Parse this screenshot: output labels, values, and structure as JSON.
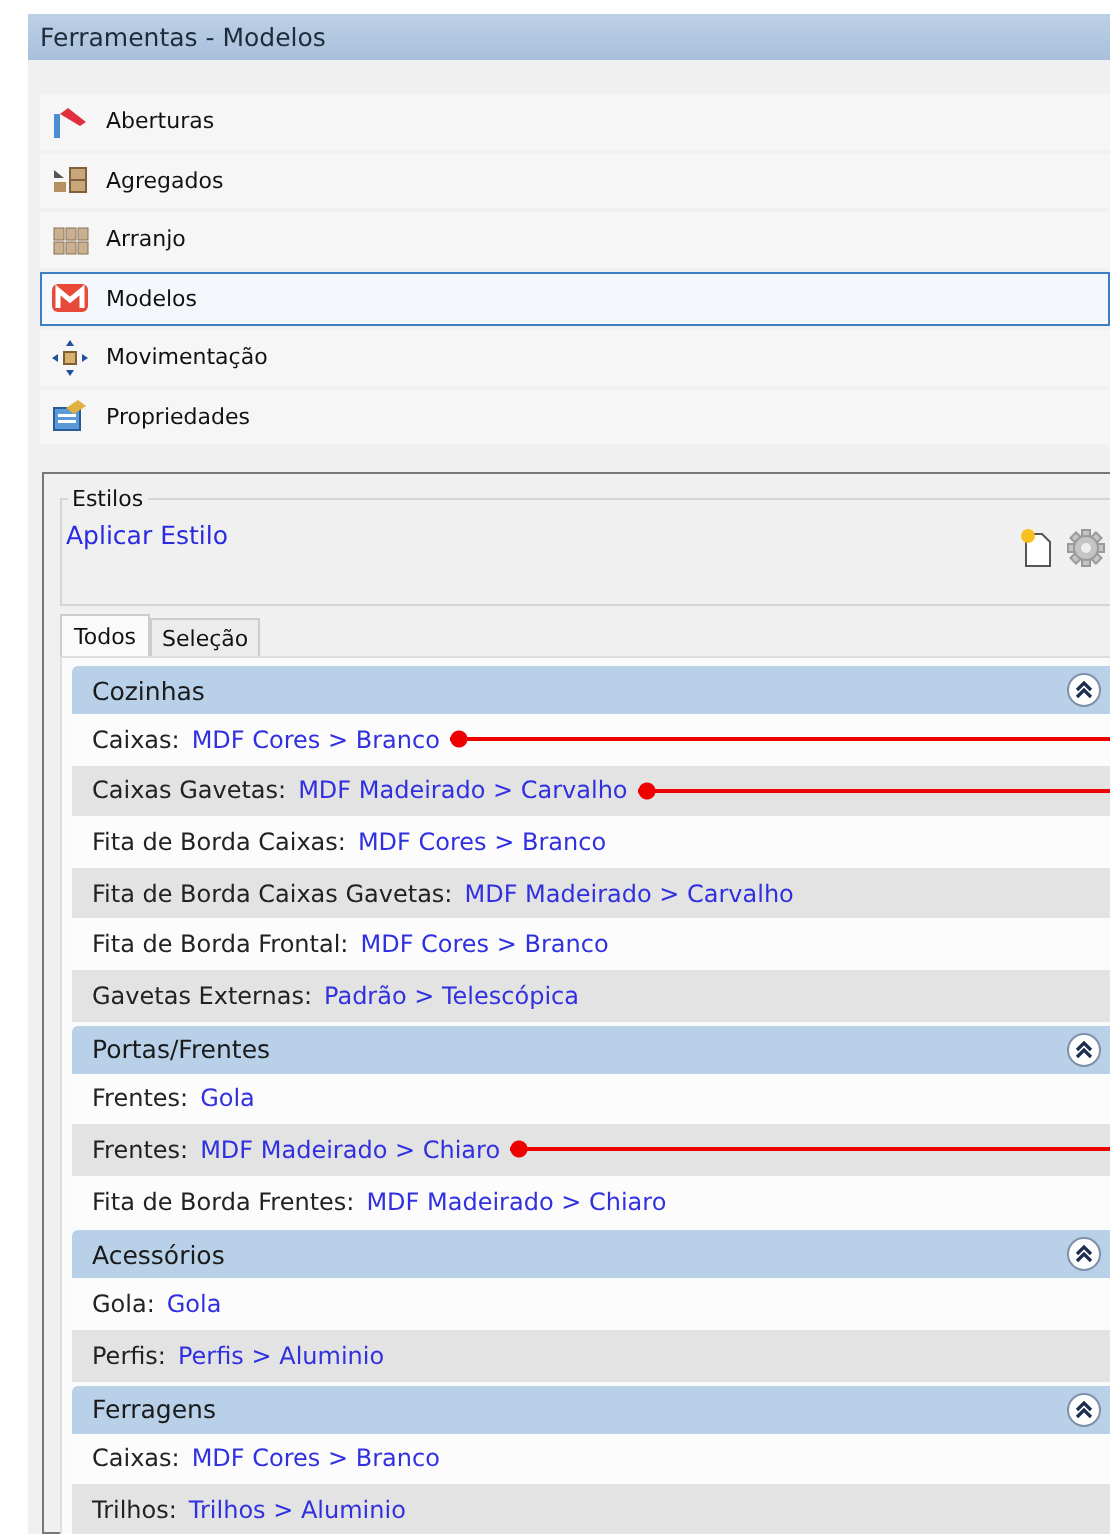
{
  "window": {
    "title": "Ferramentas - Modelos"
  },
  "tools": [
    {
      "label": "Aberturas",
      "kind": "flag",
      "selected": false
    },
    {
      "label": "Agregados",
      "kind": "drawers",
      "selected": false
    },
    {
      "label": "Arranjo",
      "kind": "grid",
      "selected": false
    },
    {
      "label": "Modelos",
      "kind": "m",
      "selected": true
    },
    {
      "label": "Movimentação",
      "kind": "move",
      "selected": false
    },
    {
      "label": "Propriedades",
      "kind": "props",
      "selected": false
    }
  ],
  "styles": {
    "title": "Estilos",
    "link": "Aplicar Estilo"
  },
  "tabs": [
    {
      "label": "Todos",
      "selected": true
    },
    {
      "label": "Seleção",
      "selected": false
    }
  ],
  "groups": [
    {
      "title": "Cozinhas",
      "expanded": true,
      "rows": [
        {
          "label": "Caixas:",
          "value": "MDF Cores > Branco",
          "callout": true
        },
        {
          "label": "Caixas Gavetas:",
          "value": "MDF Madeirado > Carvalho",
          "callout": true
        },
        {
          "label": "Fita de Borda Caixas:",
          "value": "MDF Cores > Branco",
          "callout": false
        },
        {
          "label": "Fita de Borda Caixas Gavetas:",
          "value": "MDF Madeirado > Carvalho",
          "callout": false
        },
        {
          "label": "Fita de Borda Frontal:",
          "value": "MDF Cores > Branco",
          "callout": false
        },
        {
          "label": "Gavetas Externas:",
          "value": "Padrão > Telescópica",
          "callout": false
        }
      ]
    },
    {
      "title": "Portas/Frentes",
      "expanded": true,
      "rows": [
        {
          "label": "Frentes:",
          "value": "Gola",
          "callout": false
        },
        {
          "label": "Frentes:",
          "value": "MDF Madeirado > Chiaro",
          "callout": true
        },
        {
          "label": "Fita de Borda Frentes:",
          "value": "MDF Madeirado > Chiaro",
          "callout": false
        }
      ]
    },
    {
      "title": "Acessórios",
      "expanded": true,
      "rows": [
        {
          "label": "Gola:",
          "value": "Gola",
          "callout": false
        },
        {
          "label": "Perfis:",
          "value": "Perfis > Aluminio",
          "callout": false
        }
      ]
    },
    {
      "title": "Ferragens",
      "expanded": true,
      "rows": [
        {
          "label": "Caixas:",
          "value": "MDF Cores > Branco",
          "callout": false
        },
        {
          "label": "Trilhos:",
          "value": "Trilhos > Aluminio",
          "callout": false
        }
      ]
    }
  ]
}
